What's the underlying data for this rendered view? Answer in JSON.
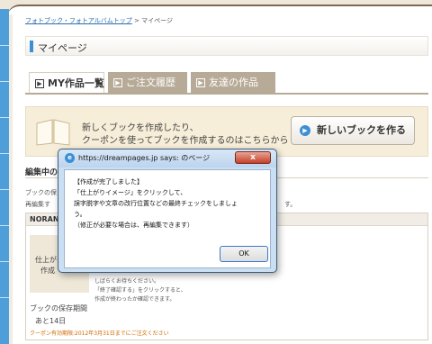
{
  "breadcrumb": {
    "items": [
      "フォトブック・フォトアルバムトップ",
      "マイページ"
    ],
    "separator": ">"
  },
  "page": {
    "title": "マイページ"
  },
  "tabs": [
    {
      "label": "MY作品一覧",
      "active": true
    },
    {
      "label": "ご注文履歴",
      "active": false
    },
    {
      "label": "友達の作品",
      "active": false
    }
  ],
  "promo": {
    "line1": "新しくブックを作成したり、",
    "line2": "クーポンを使ってブックを作成するのはこちらから",
    "button_label": "新しいブックを作る"
  },
  "section": {
    "heading": "編集中の",
    "text1": "ブックの保",
    "text2": "再編集す",
    "text3": "す。"
  },
  "item": {
    "name": "NORAN",
    "thumb_line1": "仕上がり",
    "thumb_line2": "作成",
    "note1": "しばらくお待ちください。",
    "note2": "「終了確認する」をクリックすると、",
    "note3": "作成が終わったか確認できます。",
    "storage_label": "ブックの保存期間",
    "days_left": "あと14日",
    "coupon_text": "クーポン有効期限:2012年3月31日までにご注文ください"
  },
  "dialog": {
    "title": "https://dreampages.jp says: のページ",
    "close_label": "x",
    "lines": [
      "【作成が完了しました】",
      "「仕上がりイメージ」をクリックして、",
      "誤字脱字や文章の改行位置などの最終チェックをしましょ",
      "う。",
      "（修正が必要な場合は、再編集できます）"
    ],
    "ok_label": "OK"
  },
  "colors": {
    "accent_blue": "#3d8fd3",
    "tab_inactive": "#b7ab97",
    "promo_bg": "#f7eed9",
    "dialog_frame": "#cbdff2",
    "close_red": "#c4402a",
    "coupon_orange": "#d06a00"
  },
  "icons": {
    "arrow_tab": "square-arrow-icon",
    "promo_book": "open-book-icon",
    "dialog_browser": "ie-icon"
  }
}
